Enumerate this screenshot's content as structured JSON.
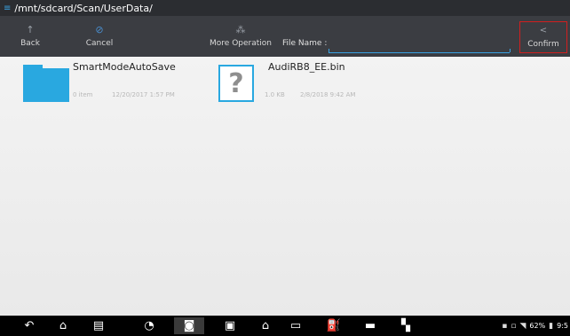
{
  "path_bar": {
    "path": "/mnt/sdcard/Scan/UserData/"
  },
  "toolbar": {
    "back_label": "Back",
    "cancel_label": "Cancel",
    "more_label": "More Operation",
    "file_name_label": "File Name :",
    "file_name_value": "",
    "confirm_label": "Confirm"
  },
  "files": [
    {
      "name": "SmartModeAutoSave",
      "type": "folder",
      "size": "0 item",
      "modified": "12/20/2017 1:57 PM"
    },
    {
      "name": "AudiRB8_EE.bin",
      "type": "unknown-file",
      "size": "1.0 KB",
      "modified": "2/8/2018 9:42 AM"
    }
  ],
  "status": {
    "battery": "62%",
    "time": "9:5"
  },
  "icons": {
    "back": "up-arrow-icon",
    "cancel": "cancel-icon",
    "more": "more-operation-icon",
    "confirm": "confirm-icon",
    "nav": [
      "back-icon",
      "home-icon",
      "recent-apps-icon",
      "search-icon",
      "camera-icon",
      "image-icon",
      "house-icon",
      "vci-icon",
      "fuel-icon",
      "car-icon",
      "car-link-icon"
    ]
  },
  "colors": {
    "accent": "#29a8e0",
    "confirm_border": "#d11f1f",
    "toolbar": "#3b3d42"
  }
}
